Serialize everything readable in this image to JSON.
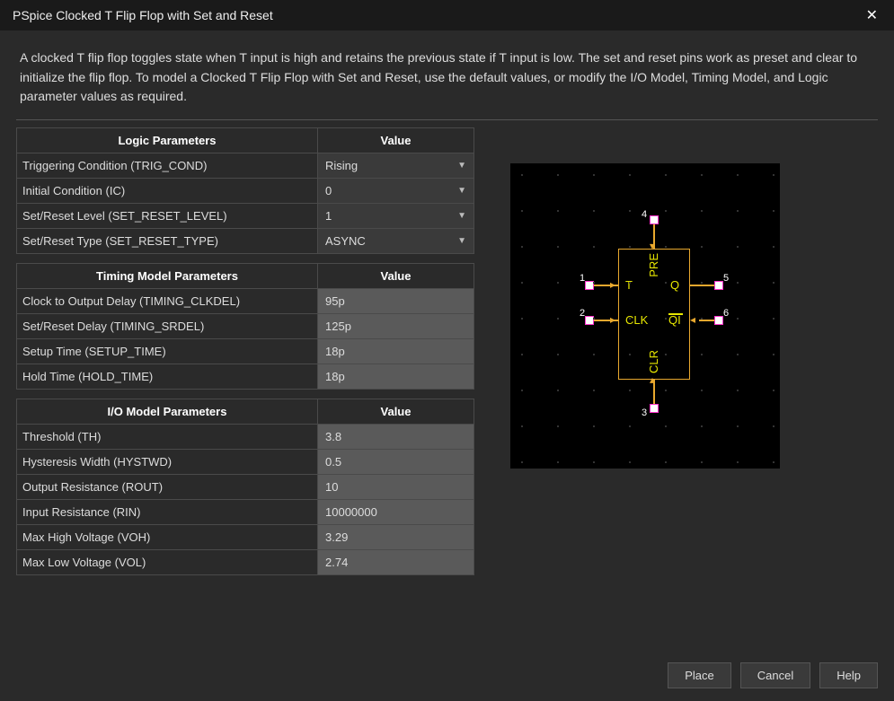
{
  "window": {
    "title": "PSpice Clocked T Flip Flop with Set and Reset"
  },
  "description": "A clocked T flip flop toggles state when T input is high and retains the previous state if T input is low. The set and reset pins work as preset and clear to initialize the flip flop. To model a Clocked T Flip Flop with Set and Reset, use the default values, or modify the I/O Model, Timing Model, and Logic parameter values as required.",
  "sections": {
    "logic": {
      "header_param": "Logic Parameters",
      "header_value": "Value",
      "rows": [
        {
          "label": "Triggering Condition (TRIG_COND)",
          "value": "Rising",
          "type": "select"
        },
        {
          "label": "Initial Condition (IC)",
          "value": "0",
          "type": "select"
        },
        {
          "label": "Set/Reset Level (SET_RESET_LEVEL)",
          "value": "1",
          "type": "select"
        },
        {
          "label": "Set/Reset Type (SET_RESET_TYPE)",
          "value": "ASYNC",
          "type": "select"
        }
      ]
    },
    "timing": {
      "header_param": "Timing Model Parameters",
      "header_value": "Value",
      "rows": [
        {
          "label": "Clock to Output Delay (TIMING_CLKDEL)",
          "value": "95p",
          "type": "input"
        },
        {
          "label": "Set/Reset Delay (TIMING_SRDEL)",
          "value": "125p",
          "type": "input"
        },
        {
          "label": "Setup Time (SETUP_TIME)",
          "value": "18p",
          "type": "input"
        },
        {
          "label": "Hold Time (HOLD_TIME)",
          "value": "18p",
          "type": "input"
        }
      ]
    },
    "io": {
      "header_param": "I/O Model Parameters",
      "header_value": "Value",
      "rows": [
        {
          "label": "Threshold (TH)",
          "value": "3.8",
          "type": "input"
        },
        {
          "label": "Hysteresis Width (HYSTWD)",
          "value": "0.5",
          "type": "input"
        },
        {
          "label": "Output Resistance (ROUT)",
          "value": "10",
          "type": "input"
        },
        {
          "label": "Input Resistance (RIN)",
          "value": "10000000",
          "type": "input"
        },
        {
          "label": "Max High Voltage (VOH)",
          "value": "3.29",
          "type": "input"
        },
        {
          "label": "Max Low Voltage (VOL)",
          "value": "2.74",
          "type": "input"
        }
      ]
    }
  },
  "schematic": {
    "pins": {
      "top": {
        "num": "4",
        "label": "PRE"
      },
      "left1": {
        "num": "1",
        "label": "T"
      },
      "left2": {
        "num": "2",
        "label": "CLK"
      },
      "right1": {
        "num": "5",
        "label": "Q"
      },
      "right2": {
        "num": "6",
        "label": "QI",
        "overline": true
      },
      "bottom": {
        "num": "3",
        "label": "CLR"
      }
    }
  },
  "buttons": {
    "place": "Place",
    "cancel": "Cancel",
    "help": "Help"
  }
}
